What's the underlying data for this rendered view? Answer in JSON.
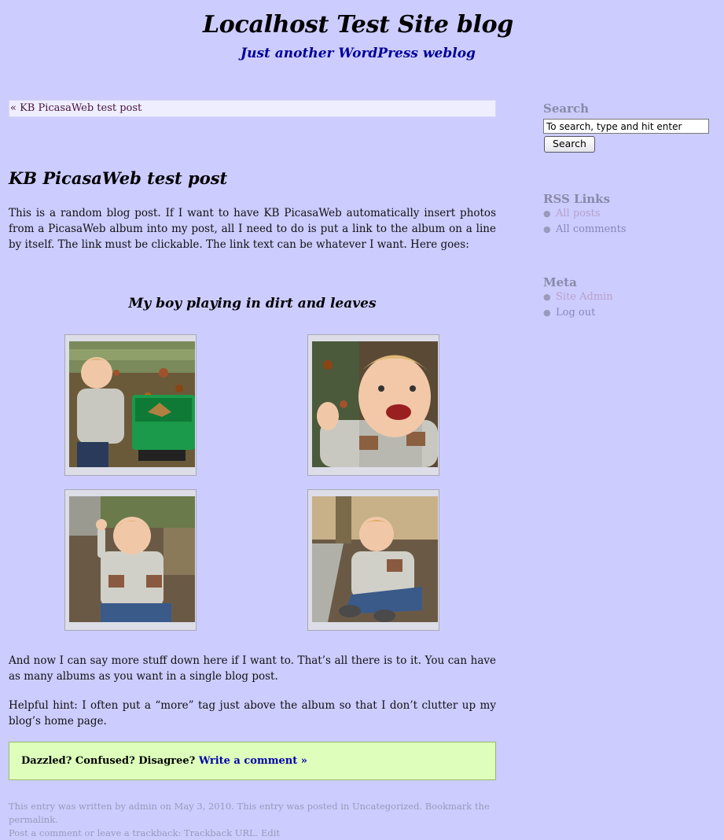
{
  "site": {
    "title": "Localhost Test Site blog",
    "description": "Just another WordPress weblog"
  },
  "navigation": {
    "previous_post": "« KB PicasaWeb test post"
  },
  "post": {
    "title": "KB PicasaWeb test post",
    "intro": "This is a random blog post. If I want to have KB PicasaWeb automatically insert photos from a PicasaWeb album into my post, all I need to do is put a link to the album on a line by itself. The link must be clickable. The link text can be whatever I want. Here goes:",
    "album": {
      "title": "My boy playing in dirt and leaves",
      "photos": [
        "photo-1",
        "photo-2",
        "photo-3",
        "photo-4"
      ]
    },
    "after_album": "And now I can say more stuff down here if I want to. That’s all there is to it. You can have as many albums as you want in a single blog post.",
    "hint": "Helpful hint: I often put a “more” tag just above the album so that I don’t clutter up my blog’s home page."
  },
  "comment_box": {
    "lead": "Dazzled? Confused? Disagree?",
    "link": "Write a comment »"
  },
  "post_meta": {
    "line1": "This entry was written by admin on May 3, 2010. This entry was posted in Uncategorized. Bookmark the permalink.",
    "line2": "Post a comment or leave a trackback: Trackback URL. Edit"
  },
  "sidebar": {
    "search": {
      "heading": "Search",
      "placeholder": "To search, type and hit enter",
      "button": "Search"
    },
    "rss": {
      "heading": "RSS Links",
      "items": [
        "All posts",
        "All comments"
      ]
    },
    "meta": {
      "heading": "Meta",
      "items": [
        "Site Admin",
        "Log out"
      ]
    }
  },
  "colors": {
    "background": "#ccccff",
    "description": "#000099",
    "comment_box": "#ddffbb",
    "link": "#0000aa"
  }
}
